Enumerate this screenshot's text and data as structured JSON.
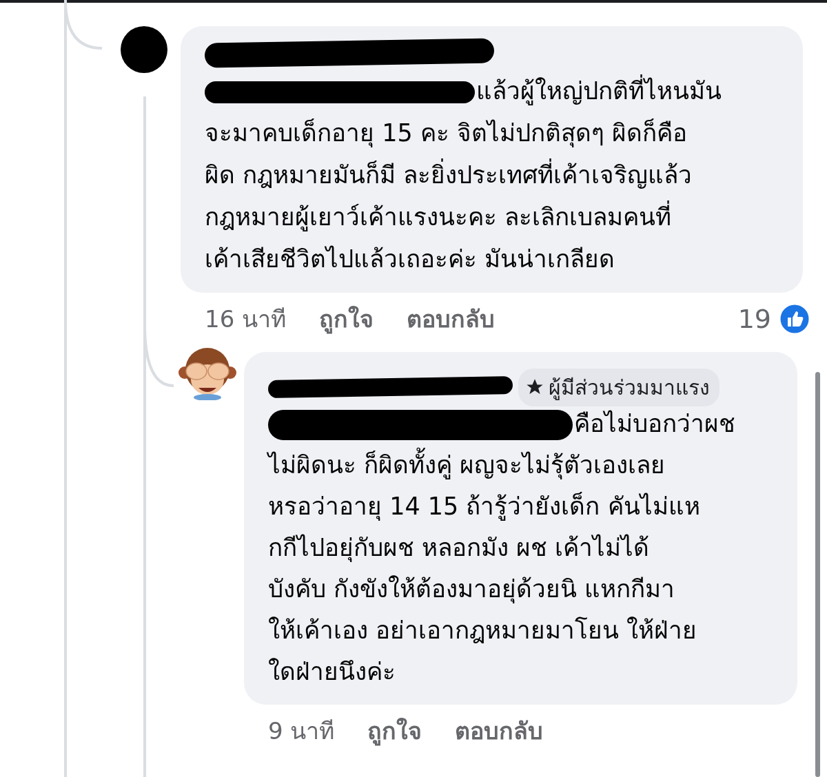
{
  "comments": [
    {
      "avatar": {
        "kind": "plain"
      },
      "author_redacted": true,
      "mention_redacted": true,
      "lines": [
        "แล้วผู้ใหญ่ปกติที่ไหนมัน",
        "จะมาคบเด็กอายุ 15 คะ จิตไม่ปกติสุดๆ ผิดก็คือ",
        "ผิด กฎหมายมันก็มี ละยิ่งประเทศที่เค้าเจริญแล้ว",
        "กฎหมายผู้เยาว์เค้าแรงนะคะ ละเลิกเบลมคนที่",
        "เค้าเสียชีวิตไปแล้วเถอะค่ะ มันน่าเกลียด"
      ],
      "time": "16 นาที",
      "like_label": "ถูกใจ",
      "reply_label": "ตอบกลับ",
      "reactions": {
        "count": "19"
      }
    },
    {
      "avatar": {
        "kind": "monkey"
      },
      "author_redacted": true,
      "badge": {
        "label": "ผู้มีส่วนร่วมมาแรง"
      },
      "mention_redacted": true,
      "lines": [
        "คือไม่บอกว่าผช",
        "ไม่ผิดนะ ก็ผิดทั้งคู่ ผญจะไม่รุ้ตัวเองเลย",
        "หรอว่าอายุ 14 15 ถ้ารู้ว่ายังเด็ก คันไม่แห",
        "กกีไปอยุ่กับผช หลอกมัง ผช เค้าไม่ได้",
        "บังคับ กังขังให้ต้องมาอยุ่ด้วยนิ แหกกีมา",
        "ให้เค้าเอง อย่าเอากฎหมายมาโยน ให้ฝ่าย",
        "ใดฝ่ายนึงค่ะ"
      ],
      "time": "9 นาที",
      "like_label": "ถูกใจ",
      "reply_label": "ตอบกลับ"
    }
  ]
}
